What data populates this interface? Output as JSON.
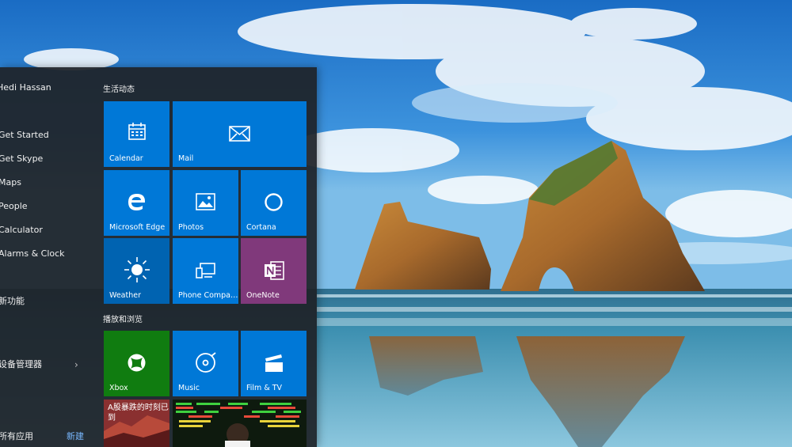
{
  "user": {
    "name": "Hedi Hassan"
  },
  "app_list": [
    {
      "label": "Get Started"
    },
    {
      "label": "Get Skype"
    },
    {
      "label": "Maps"
    },
    {
      "label": "People"
    },
    {
      "label": "Calculator"
    },
    {
      "label": "Alarms & Clock"
    },
    {
      "label": "新功能"
    },
    {
      "label": "设备管理器"
    }
  ],
  "bottom": {
    "label": "所有应用",
    "new_label": "新建"
  },
  "groups": [
    {
      "title": "生活动态"
    },
    {
      "title": "播放和浏览"
    }
  ],
  "tiles": {
    "calendar": "Calendar",
    "mail": "Mail",
    "edge": "Microsoft Edge",
    "photos": "Photos",
    "cortana": "Cortana",
    "weather": "Weather",
    "phone": "Phone Compa…",
    "onenote": "OneNote",
    "xbox": "Xbox",
    "music": "Music",
    "movies": "Film & TV",
    "news": "A股暴跌的时刻已到"
  },
  "colors": {
    "tile_blue": "#0078d7",
    "onenote_purple": "#80397b",
    "xbox_green": "#107c10"
  }
}
